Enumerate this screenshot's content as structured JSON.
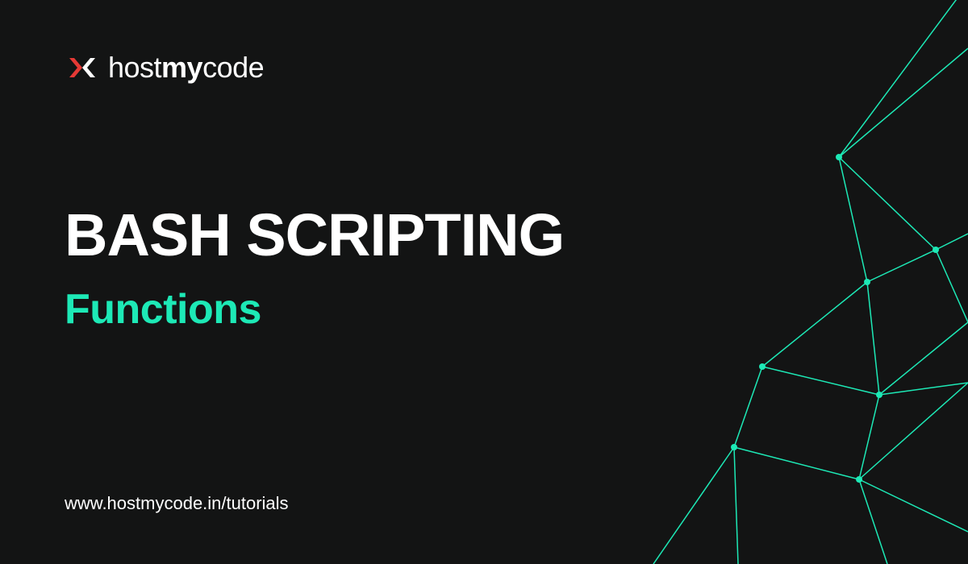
{
  "logo": {
    "brand_part1": "host",
    "brand_part2": "my",
    "brand_part3": "code"
  },
  "content": {
    "title": "BASH SCRIPTING",
    "subtitle": "Functions"
  },
  "footer": {
    "url": "www.hostmycode.in/tutorials"
  },
  "colors": {
    "background": "#131414",
    "accent": "#1de9b6",
    "text": "#ffffff",
    "logo_accent": "#e53935"
  }
}
